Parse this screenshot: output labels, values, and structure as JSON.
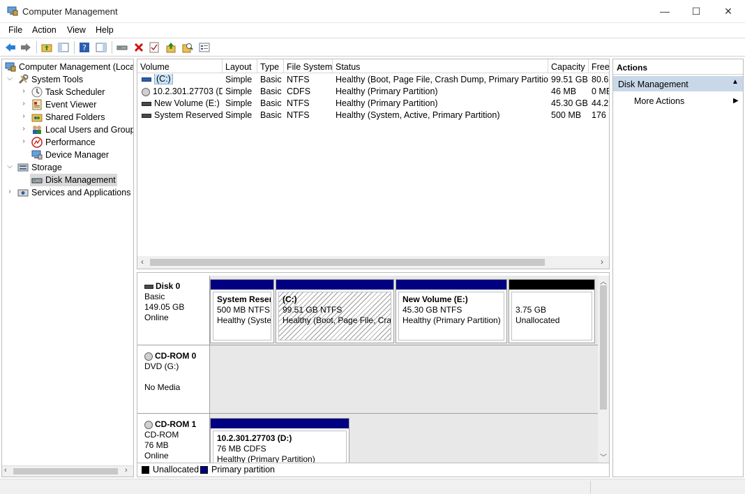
{
  "window": {
    "title": "Computer Management",
    "minimize_glyph": "—",
    "maximize_glyph": "☐",
    "close_glyph": "✕"
  },
  "menu": [
    "File",
    "Action",
    "View",
    "Help"
  ],
  "tree": {
    "root": "Computer Management (Local",
    "system_tools": "System Tools",
    "task_scheduler": "Task Scheduler",
    "event_viewer": "Event Viewer",
    "shared_folders": "Shared Folders",
    "local_users": "Local Users and Groups",
    "performance": "Performance",
    "device_manager": "Device Manager",
    "storage": "Storage",
    "disk_management": "Disk Management",
    "services": "Services and Applications"
  },
  "volumes": {
    "columns": [
      "Volume",
      "Layout",
      "Type",
      "File System",
      "Status",
      "Capacity",
      "Free"
    ],
    "rows": [
      [
        "(C:)",
        "Simple",
        "Basic",
        "NTFS",
        "Healthy (Boot, Page File, Crash Dump, Primary Partition)",
        "99.51 GB",
        "80.6"
      ],
      [
        "10.2.301.27703 (D:)",
        "Simple",
        "Basic",
        "CDFS",
        "Healthy (Primary Partition)",
        "46 MB",
        "0 ME"
      ],
      [
        "New Volume (E:)",
        "Simple",
        "Basic",
        "NTFS",
        "Healthy (Primary Partition)",
        "45.30 GB",
        "44.2"
      ],
      [
        "System Reserved",
        "Simple",
        "Basic",
        "NTFS",
        "Healthy (System, Active, Primary Partition)",
        "500 MB",
        "176 I"
      ]
    ]
  },
  "disks": {
    "disk0": {
      "name": "Disk 0",
      "type": "Basic",
      "size": "149.05 GB",
      "state": "Online",
      "parts": [
        {
          "title": "System Reser",
          "line2": "500 MB NTFS",
          "line3": "Healthy (Syster"
        },
        {
          "title": "(C:)",
          "line2": "99.51 GB NTFS",
          "line3": "Healthy (Boot, Page File, Crasl"
        },
        {
          "title": "New Volume  (E:)",
          "line2": "45.30 GB NTFS",
          "line3": "Healthy (Primary Partition)"
        },
        {
          "title": "",
          "line2": "3.75 GB",
          "line3": "Unallocated"
        }
      ]
    },
    "cdrom0": {
      "name": "CD-ROM 0",
      "type": "DVD (G:)",
      "blank": "",
      "state": "No Media"
    },
    "cdrom1": {
      "name": "CD-ROM 1",
      "type": "CD-ROM",
      "size": "76 MB",
      "state": "Online",
      "part": {
        "title": "10.2.301.27703  (D:)",
        "line2": "76 MB CDFS",
        "line3": "Healthy (Primary Partition)"
      }
    }
  },
  "legend": {
    "unallocated": "Unallocated",
    "primary": "Primary partition"
  },
  "actions": {
    "title": "Actions",
    "section": "Disk Management",
    "more": "More Actions"
  },
  "colors": {
    "primary_partition": "#000080",
    "unallocated": "#000000",
    "accent_selection": "#c8d8e8"
  }
}
